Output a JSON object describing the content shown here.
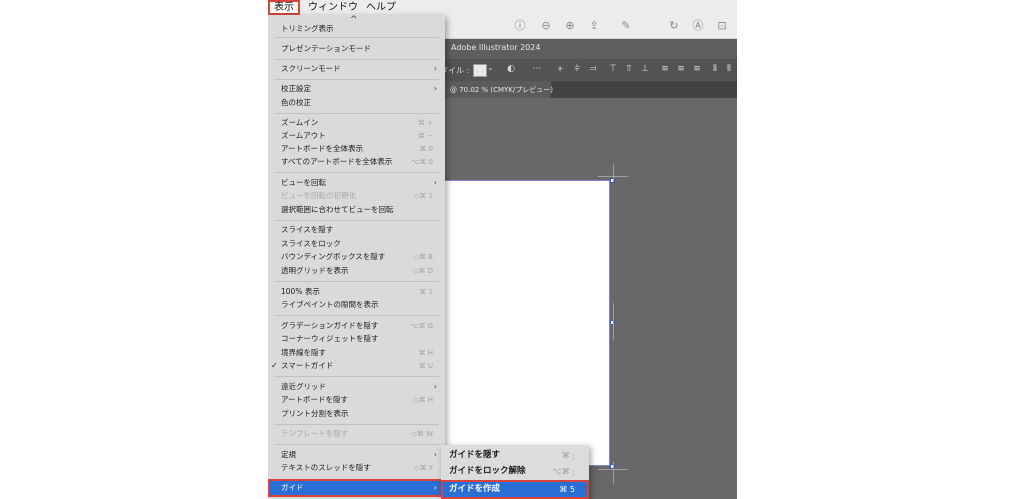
{
  "menubar": {
    "view": "表示",
    "window": "ウィンドウ",
    "help": "ヘルプ"
  },
  "titlebar": {
    "title": "Adobe Illustrator 2024"
  },
  "controlbar": {
    "tile_label": "タイル :"
  },
  "tab": {
    "label": "@ 70.02 % (CMYK/プレビュー)"
  },
  "dropdown": {
    "scroll_arrow": "^",
    "top_item": "トリミング表示",
    "items": [
      {
        "label": "プレゼンテーションモード",
        "shortcut": ""
      },
      {
        "label": "スクリーンモード",
        "arrow": "›"
      },
      {
        "label": "校正設定",
        "arrow": "›"
      },
      {
        "label": "色の校正",
        "shortcut": ""
      },
      {
        "label": "ズームイン",
        "shortcut": "⌘ +"
      },
      {
        "label": "ズームアウト",
        "shortcut": "⌘ −"
      },
      {
        "label": "アートボードを全体表示",
        "shortcut": "⌘ 0"
      },
      {
        "label": "すべてのアートボードを全体表示",
        "shortcut": "⌥⌘ 0"
      },
      {
        "label": "ビューを回転",
        "arrow": "›"
      },
      {
        "label": "ビューを回転の初期化",
        "shortcut": "◇⌘ 1"
      },
      {
        "label": "選択範囲に合わせてビューを回転",
        "shortcut": ""
      },
      {
        "label": "スライスを隠す",
        "shortcut": ""
      },
      {
        "label": "スライスをロック",
        "shortcut": ""
      },
      {
        "label": "バウンディングボックスを隠す",
        "shortcut": "◇⌘ B"
      },
      {
        "label": "透明グリッドを表示",
        "shortcut": "◇⌘ D"
      },
      {
        "label": "100% 表示",
        "shortcut": "⌘ 1"
      },
      {
        "label": "ライブペイントの隙間を表示",
        "shortcut": ""
      },
      {
        "label": "グラデーションガイドを隠す",
        "shortcut": "⌥⌘ G"
      },
      {
        "label": "コーナーウィジェットを隠す",
        "shortcut": ""
      },
      {
        "label": "境界線を隠す",
        "shortcut": "⌘ H"
      },
      {
        "label": "スマートガイド",
        "shortcut": "⌘ U",
        "check": "✓"
      },
      {
        "label": "遠近グリッド",
        "arrow": "›"
      },
      {
        "label": "アートボードを隠す",
        "shortcut": "◇⌘ H"
      },
      {
        "label": "プリント分割を表示",
        "shortcut": ""
      },
      {
        "label": "テンプレートを隠す",
        "shortcut": "◇⌘ W"
      },
      {
        "label": "定規",
        "arrow": "›"
      },
      {
        "label": "テキストのスレッドを隠す",
        "shortcut": "◇⌘ Y"
      },
      {
        "label": "ガイド",
        "arrow": "›"
      }
    ]
  },
  "submenu": {
    "items": [
      {
        "label": "ガイドを隠す",
        "shortcut": "⌘ ;"
      },
      {
        "label": "ガイドをロック解除",
        "shortcut": "⌥⌘ ;"
      },
      {
        "label": "ガイドを作成",
        "shortcut": "⌘ 5"
      }
    ]
  },
  "colors": {
    "highlight": "#2a6fd6",
    "annotation_border": "#d6443c",
    "canvas": "#686868"
  }
}
